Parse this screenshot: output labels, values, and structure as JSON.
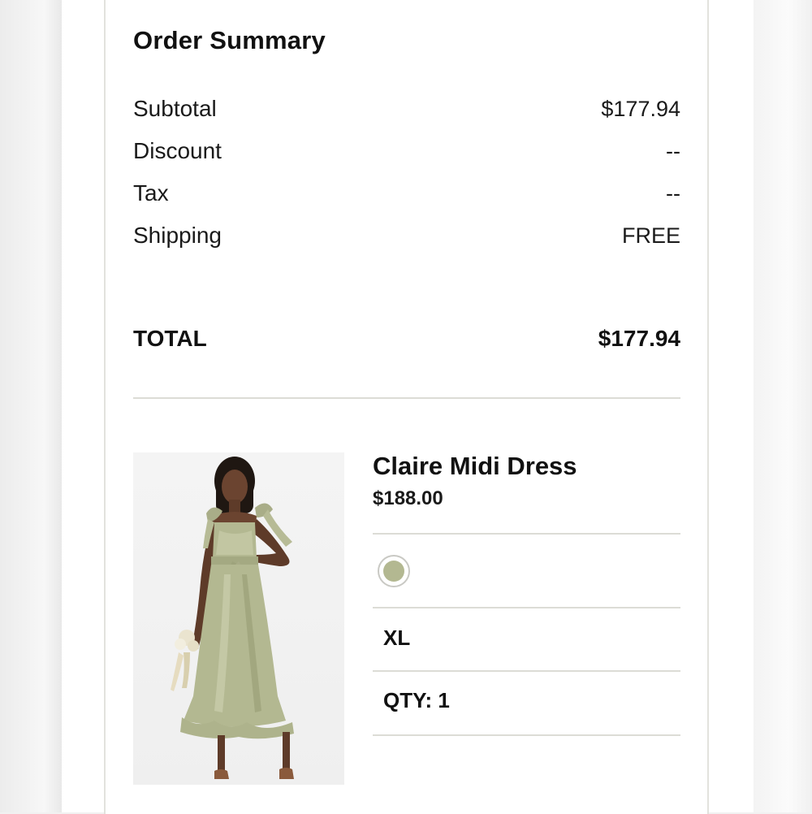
{
  "order_summary": {
    "title": "Order Summary",
    "rows": [
      {
        "label": "Subtotal",
        "value": "$177.94"
      },
      {
        "label": "Discount",
        "value": "--"
      },
      {
        "label": "Tax",
        "value": "--"
      },
      {
        "label": "Shipping",
        "value": "FREE"
      }
    ],
    "total_label": "TOTAL",
    "total_value": "$177.94"
  },
  "product": {
    "name": "Claire Midi Dress",
    "price": "$188.00",
    "color_swatch": "#b3b891",
    "size": "XL",
    "qty": "QTY: 1",
    "image_icon": "dress-photo"
  }
}
